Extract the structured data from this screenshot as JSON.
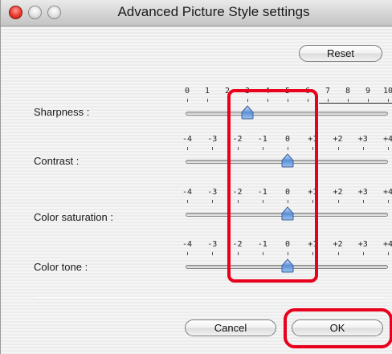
{
  "window": {
    "title": "Advanced Picture Style settings"
  },
  "buttons": {
    "reset": "Reset",
    "cancel": "Cancel",
    "ok": "OK"
  },
  "sliders": [
    {
      "label": "Sharpness :",
      "ticks": [
        "0",
        "1",
        "2",
        "3",
        "4",
        "5",
        "6",
        "7",
        "8",
        "9",
        "10"
      ],
      "value": "3"
    },
    {
      "label": "Contrast :",
      "ticks": [
        "-4",
        "-3",
        "-2",
        "-1",
        "0",
        "+1",
        "+2",
        "+3",
        "+4"
      ],
      "value": "0"
    },
    {
      "label": "Color saturation :",
      "ticks": [
        "-4",
        "-3",
        "-2",
        "-1",
        "0",
        "+1",
        "+2",
        "+3",
        "+4"
      ],
      "value": "0"
    },
    {
      "label": "Color tone :",
      "ticks": [
        "-4",
        "-3",
        "-2",
        "-1",
        "0",
        "+1",
        "+2",
        "+3",
        "+4"
      ],
      "value": "0"
    }
  ],
  "colors": {
    "highlight": "#e8001c",
    "thumb": "#5b8fd6"
  }
}
